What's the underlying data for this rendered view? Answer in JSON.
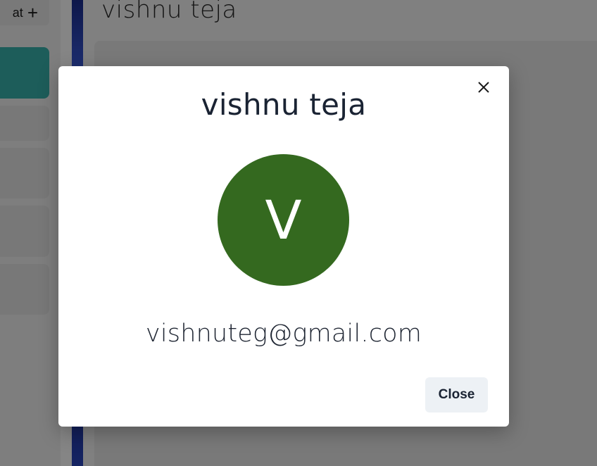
{
  "sidebar": {
    "new_chat_label": "at",
    "plus_icon": "plus-icon",
    "active_color": "#38b2ac"
  },
  "main": {
    "chat_title": "vishnu teja"
  },
  "modal": {
    "title": "vishnu teja",
    "avatar_initial": "V",
    "avatar_color": "#34691f",
    "email": "vishnuteg@gmail.com",
    "close_button_label": "Close",
    "close_icon": "close-icon"
  }
}
